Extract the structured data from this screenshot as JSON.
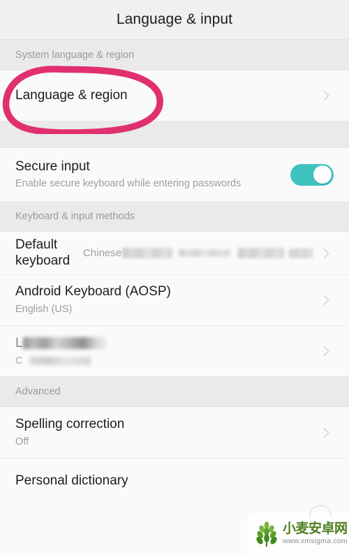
{
  "header": {
    "title": "Language & input"
  },
  "sections": [
    {
      "name": "system-language-region",
      "label": "System language & region",
      "rows": [
        {
          "name": "language-and-region",
          "title": "Language & region",
          "subtitle": "",
          "value": "",
          "accessory": "chevron-right-icon"
        }
      ]
    },
    {
      "name": "secure-input-section",
      "label": "",
      "rows": [
        {
          "name": "secure-input",
          "title": "Secure input",
          "subtitle": "Enable secure keyboard while entering passwords",
          "value": "",
          "accessory": "toggle-on"
        }
      ]
    },
    {
      "name": "keyboard-input-methods",
      "label": "Keyboard & input methods",
      "rows": [
        {
          "name": "default-keyboard",
          "title": "Default keyboard",
          "subtitle": "",
          "value": "Chinese",
          "value_redacted": true,
          "accessory": "chevron-right-icon"
        },
        {
          "name": "android-keyboard-aosp",
          "title": "Android Keyboard (AOSP)",
          "subtitle": "English (US)",
          "value": "",
          "accessory": "chevron-right-icon"
        },
        {
          "name": "redacted-keyboard",
          "title": "L",
          "title_redacted": true,
          "subtitle": "C",
          "subtitle_redacted": true,
          "value": "",
          "accessory": "chevron-right-icon"
        }
      ]
    },
    {
      "name": "advanced",
      "label": "Advanced",
      "rows": [
        {
          "name": "spelling-correction",
          "title": "Spelling correction",
          "subtitle": "Off",
          "value": "",
          "accessory": "chevron-right-icon"
        },
        {
          "name": "personal-dictionary",
          "title": "Personal dictionary",
          "subtitle": "",
          "value": "",
          "accessory": "none"
        }
      ]
    }
  ],
  "annotation": {
    "name": "pink-circle-highlight",
    "target": "Language & region",
    "color": "#e0306f"
  },
  "watermark": {
    "cn_text": "小麦安卓网",
    "url": "www.xmsigma.com",
    "logo_color": "#6aa827"
  },
  "colors": {
    "toggle_on": "#3fc3c1",
    "title_bar": "#f0f0f0",
    "section_header": "#eaeaea",
    "row_bg": "#fafafa",
    "text_primary": "#1d1d1d",
    "text_secondary": "#9e9e9e"
  }
}
